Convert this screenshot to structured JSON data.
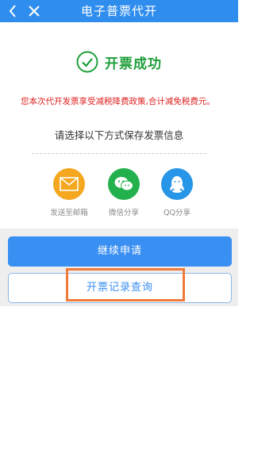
{
  "header": {
    "title": "电子普票代开",
    "back_icon": "chevron-left-icon",
    "close_icon": "close-icon",
    "background": "#2f8ded"
  },
  "success": {
    "icon": "check-circle-icon",
    "text": "开票成功",
    "color": "#1e9e3a"
  },
  "notice": {
    "text": "您本次代开发票享受减税降费政策,合计减免税费元。",
    "color": "#e02020"
  },
  "prompt": "请选择以下方式保存发票信息",
  "share_options": [
    {
      "label": "发送至邮箱",
      "icon": "mail-icon",
      "color": "#f4a71f"
    },
    {
      "label": "微信分享",
      "icon": "wechat-icon",
      "color": "#22b14c"
    },
    {
      "label": "QQ分享",
      "icon": "qq-icon",
      "color": "#2795e8"
    }
  ],
  "buttons": {
    "continue": "继续申请",
    "records": "开票记录查询"
  }
}
